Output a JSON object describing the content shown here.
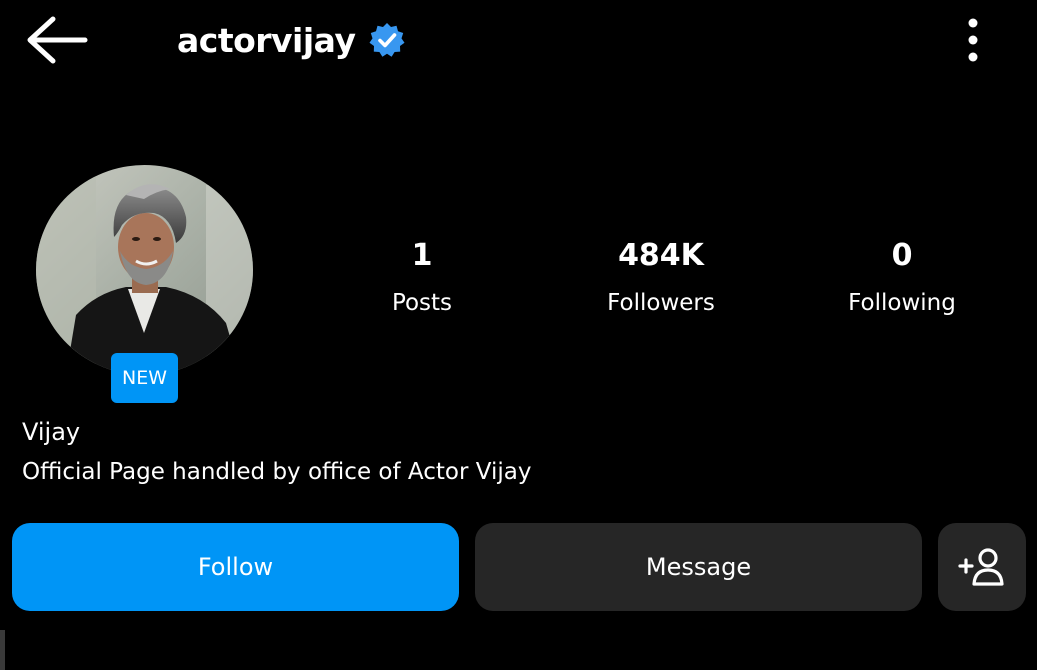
{
  "header": {
    "username": "actorvijay",
    "verified": true,
    "back_icon": "arrow-left-icon",
    "more_icon": "more-vertical-icon"
  },
  "profile": {
    "avatar_icon": "profile-photo",
    "badge": "NEW",
    "display_name": "Vijay",
    "bio": "Official Page handled by office of Actor Vijay"
  },
  "stats": [
    {
      "value": "1",
      "label": "Posts"
    },
    {
      "value": "484K",
      "label": "Followers"
    },
    {
      "value": "0",
      "label": "Following"
    }
  ],
  "actions": {
    "follow_label": "Follow",
    "message_label": "Message",
    "add_icon": "add-user-icon"
  },
  "colors": {
    "background": "#000000",
    "accent": "#0095f6",
    "secondary_button": "#262626",
    "text": "#ffffff"
  }
}
